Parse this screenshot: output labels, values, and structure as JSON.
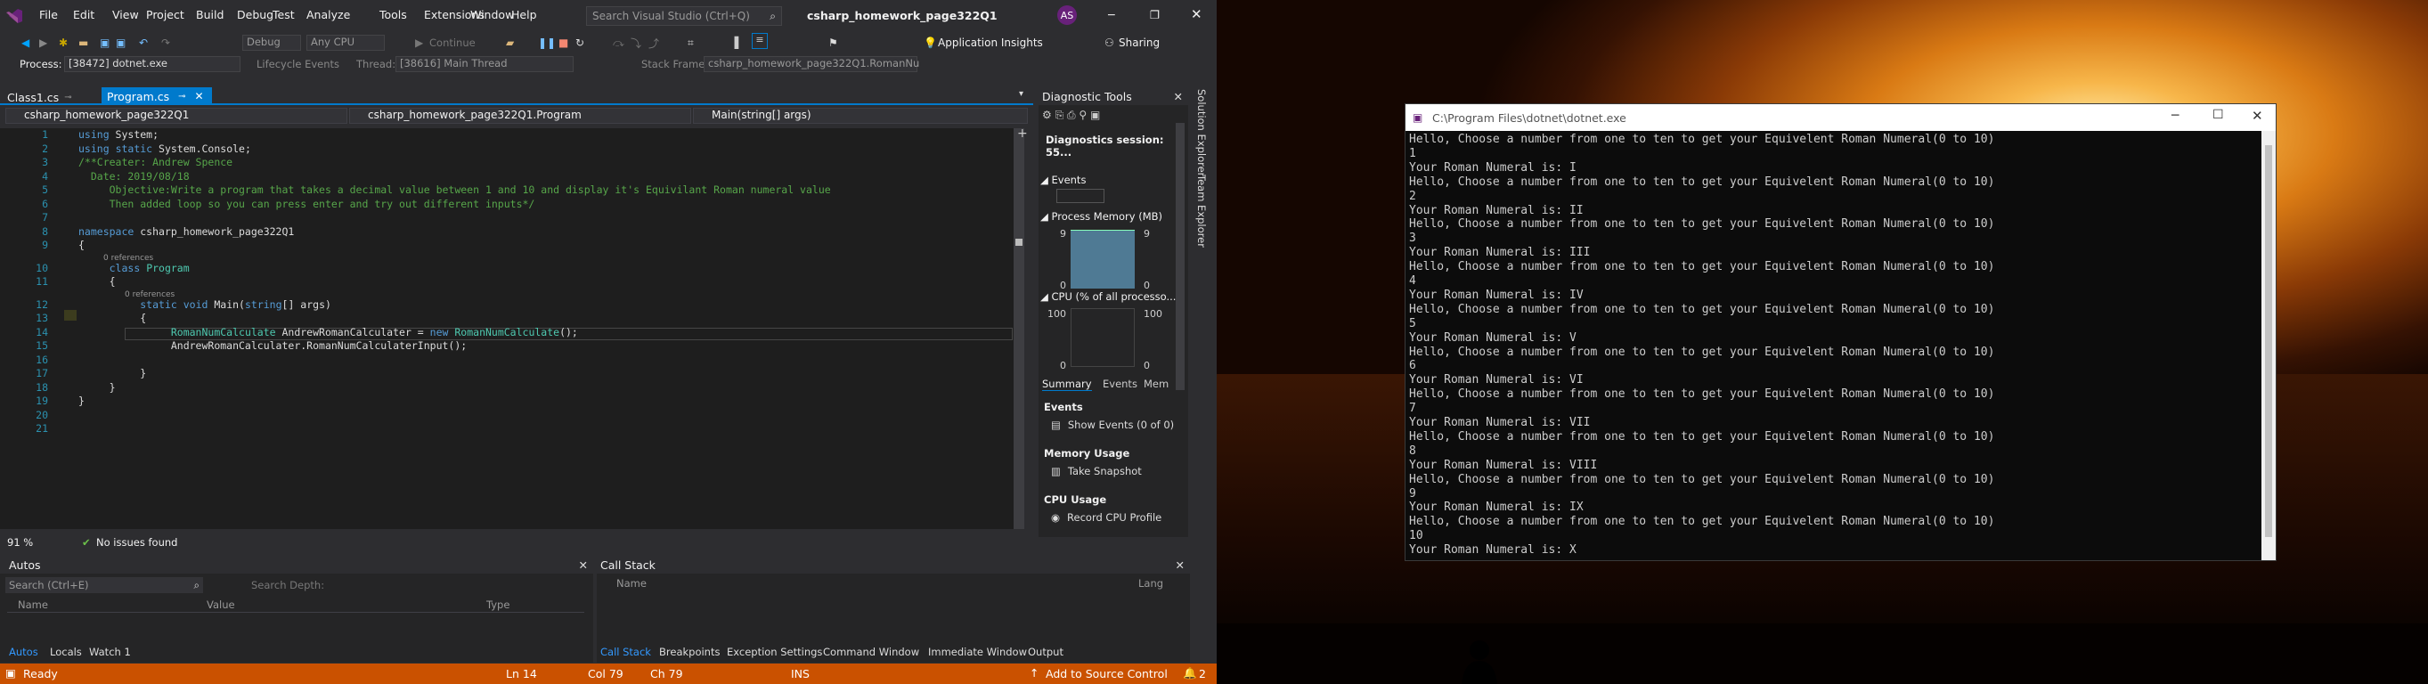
{
  "window": {
    "title": "csharp_homework_page322Q1",
    "menu": [
      "File",
      "Edit",
      "View",
      "Project",
      "Build",
      "Debug",
      "Test",
      "Analyze",
      "Tools",
      "Extensions",
      "Window",
      "Help"
    ],
    "search_placeholder": "Search Visual Studio (Ctrl+Q)",
    "user_initials": "AS",
    "sharing": "Sharing",
    "app_insights": "Application Insights",
    "config": "Debug",
    "platform": "Any CPU",
    "continue": "Continue"
  },
  "debugbar": {
    "process_label": "Process:",
    "process_value": "[38472] dotnet.exe",
    "lifecycle": "Lifecycle Events",
    "thread_label": "Thread:",
    "thread_value": "[38616] Main Thread",
    "stackframe_label": "Stack Frame:",
    "stackframe_value": "csharp_homework_page322Q1.RomanNu"
  },
  "tabs": [
    {
      "label": "Class1.cs"
    },
    {
      "label": "Program.cs"
    }
  ],
  "navbar": {
    "project": "csharp_homework_page322Q1",
    "class": "csharp_homework_page322Q1.Program",
    "member": "Main(string[] args)"
  },
  "code": {
    "lines": [
      {
        "n": "1",
        "t": "using System;"
      },
      {
        "n": "2",
        "t": "using static System.Console;"
      },
      {
        "n": "3",
        "t": "/**Creater: Andrew Spence"
      },
      {
        "n": "4",
        "t": "  Date: 2019/08/18"
      },
      {
        "n": "5",
        "t": "     Objective:Write a program that takes a decimal value between 1 and 10 and display it's Equivilant Roman numeral value"
      },
      {
        "n": "6",
        "t": "     Then added loop so you can press enter and try out different inputs*/"
      },
      {
        "n": "7",
        "t": ""
      },
      {
        "n": "8",
        "t": "namespace csharp_homework_page322Q1"
      },
      {
        "n": "9",
        "t": "{"
      },
      {
        "n": "10",
        "t": "     class Program"
      },
      {
        "n": "11",
        "t": "     {"
      },
      {
        "n": "12",
        "t": "          static void Main(string[] args)"
      },
      {
        "n": "13",
        "t": "          {"
      },
      {
        "n": "14",
        "t": "               RomanNumCalculate AndrewRomanCalculater = new RomanNumCalculate();"
      },
      {
        "n": "15",
        "t": "               AndrewRomanCalculater.RomanNumCalculaterInput();"
      },
      {
        "n": "16",
        "t": ""
      },
      {
        "n": "17",
        "t": "          }"
      },
      {
        "n": "18",
        "t": "     }"
      },
      {
        "n": "19",
        "t": "}"
      },
      {
        "n": "20",
        "t": ""
      },
      {
        "n": "21",
        "t": ""
      }
    ],
    "refs": "0 references"
  },
  "editor_status": {
    "zoom": "91 %",
    "issues": "No issues found"
  },
  "diagnostics": {
    "title": "Diagnostic Tools",
    "session": "Diagnostics session: 55...",
    "events": "Events",
    "memory": "Process Memory (MB)",
    "mem_max": "9",
    "mem_min": "0",
    "cpu": "CPU (% of all processo...",
    "cpu_max": "100",
    "cpu_min": "0",
    "subtabs": [
      "Summary",
      "Events",
      "Mem"
    ],
    "summary_events": "Events",
    "show_events": "Show Events (0 of 0)",
    "memory_usage": "Memory Usage",
    "take_snapshot": "Take Snapshot",
    "cpu_usage": "CPU Usage",
    "record_cpu": "Record CPU Profile"
  },
  "side_tabs": [
    "Solution Explorer",
    "Team Explorer"
  ],
  "autos": {
    "title": "Autos",
    "search": "Search (Ctrl+E)",
    "depth": "Search Depth:",
    "cols": [
      "Name",
      "Value",
      "Type"
    ],
    "tabs": [
      "Autos",
      "Locals",
      "Watch 1"
    ]
  },
  "callstack": {
    "title": "Call Stack",
    "cols": [
      "Name",
      "Lang"
    ],
    "tabs": [
      "Call Stack",
      "Breakpoints",
      "Exception Settings",
      "Command Window",
      "Immediate Window",
      "Output"
    ]
  },
  "statusbar": {
    "ready": "Ready",
    "ln": "Ln 14",
    "col": "Col 79",
    "ch": "Ch 79",
    "ins": "INS",
    "source_control": "Add to Source Control",
    "notifications": "2"
  },
  "console": {
    "title": "C:\\Program Files\\dotnet\\dotnet.exe",
    "lines": [
      "Hello, Choose a number from one to ten to get your Equivelent Roman Numeral(0 to 10)",
      "1",
      "Your Roman Numeral is: I",
      "Hello, Choose a number from one to ten to get your Equivelent Roman Numeral(0 to 10)",
      "2",
      "Your Roman Numeral is: II",
      "Hello, Choose a number from one to ten to get your Equivelent Roman Numeral(0 to 10)",
      "3",
      "Your Roman Numeral is: III",
      "Hello, Choose a number from one to ten to get your Equivelent Roman Numeral(0 to 10)",
      "4",
      "Your Roman Numeral is: IV",
      "Hello, Choose a number from one to ten to get your Equivelent Roman Numeral(0 to 10)",
      "5",
      "Your Roman Numeral is: V",
      "Hello, Choose a number from one to ten to get your Equivelent Roman Numeral(0 to 10)",
      "6",
      "Your Roman Numeral is: VI",
      "Hello, Choose a number from one to ten to get your Equivelent Roman Numeral(0 to 10)",
      "7",
      "Your Roman Numeral is: VII",
      "Hello, Choose a number from one to ten to get your Equivelent Roman Numeral(0 to 10)",
      "8",
      "Your Roman Numeral is: VIII",
      "Hello, Choose a number from one to ten to get your Equivelent Roman Numeral(0 to 10)",
      "9",
      "Your Roman Numeral is: IX",
      "Hello, Choose a number from one to ten to get your Equivelent Roman Numeral(0 to 10)",
      "10",
      "Your Roman Numeral is: X"
    ]
  },
  "colors": {
    "accent": "#007acc",
    "status": "#ca5100"
  }
}
